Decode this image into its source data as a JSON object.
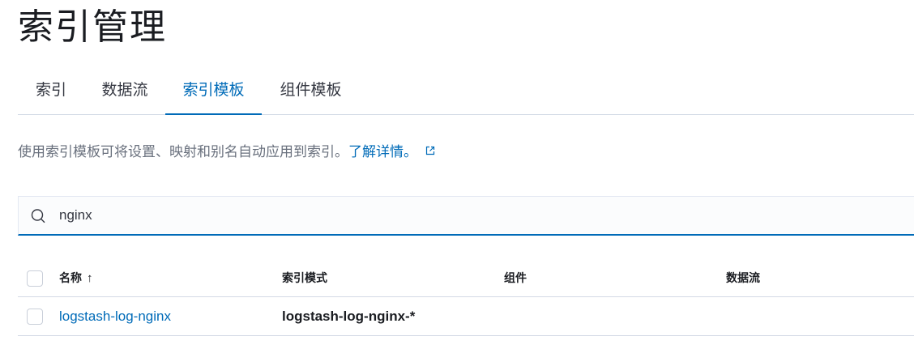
{
  "page": {
    "title": "索引管理"
  },
  "tabs": [
    {
      "label": "索引",
      "active": false
    },
    {
      "label": "数据流",
      "active": false
    },
    {
      "label": "索引模板",
      "active": true
    },
    {
      "label": "组件模板",
      "active": false
    }
  ],
  "description": {
    "text": "使用索引模板可将设置、映射和别名自动应用到索引。",
    "link_label": "了解详情。",
    "link_icon": "external-link-icon"
  },
  "search": {
    "value": "nginx",
    "icon": "search-icon"
  },
  "table": {
    "columns": [
      "名称",
      "索引模式",
      "组件",
      "数据流"
    ],
    "sort_indicator": "↑",
    "rows": [
      {
        "name": "logstash-log-nginx",
        "pattern": "logstash-log-nginx-*",
        "components": "",
        "data_stream": ""
      }
    ]
  },
  "colors": {
    "accent": "#006bb8",
    "text": "#343741",
    "subdued": "#69707d",
    "border": "#d3dae6"
  }
}
